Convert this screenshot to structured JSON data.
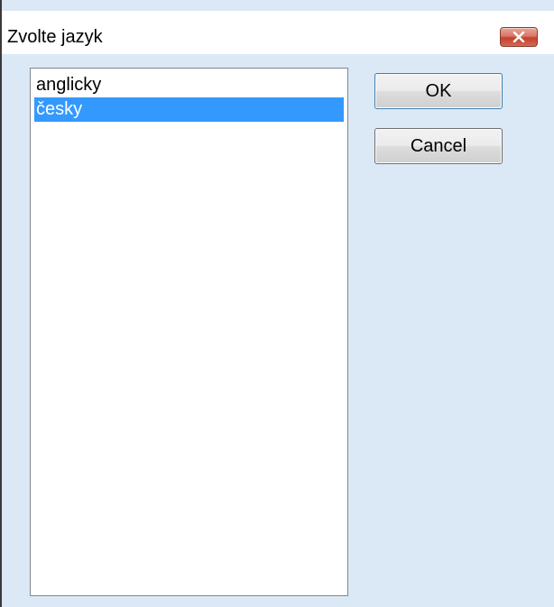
{
  "window": {
    "title": "Zvolte jazyk",
    "close_icon": "close-icon"
  },
  "language_list": {
    "items": [
      {
        "label": "anglicky",
        "selected": false
      },
      {
        "label": "česky",
        "selected": true
      }
    ],
    "selection_color": "#3399ff"
  },
  "buttons": {
    "ok_label": "OK",
    "cancel_label": "Cancel"
  },
  "colors": {
    "dialog_background": "#dbe8f5",
    "close_button": "#c2402e"
  }
}
